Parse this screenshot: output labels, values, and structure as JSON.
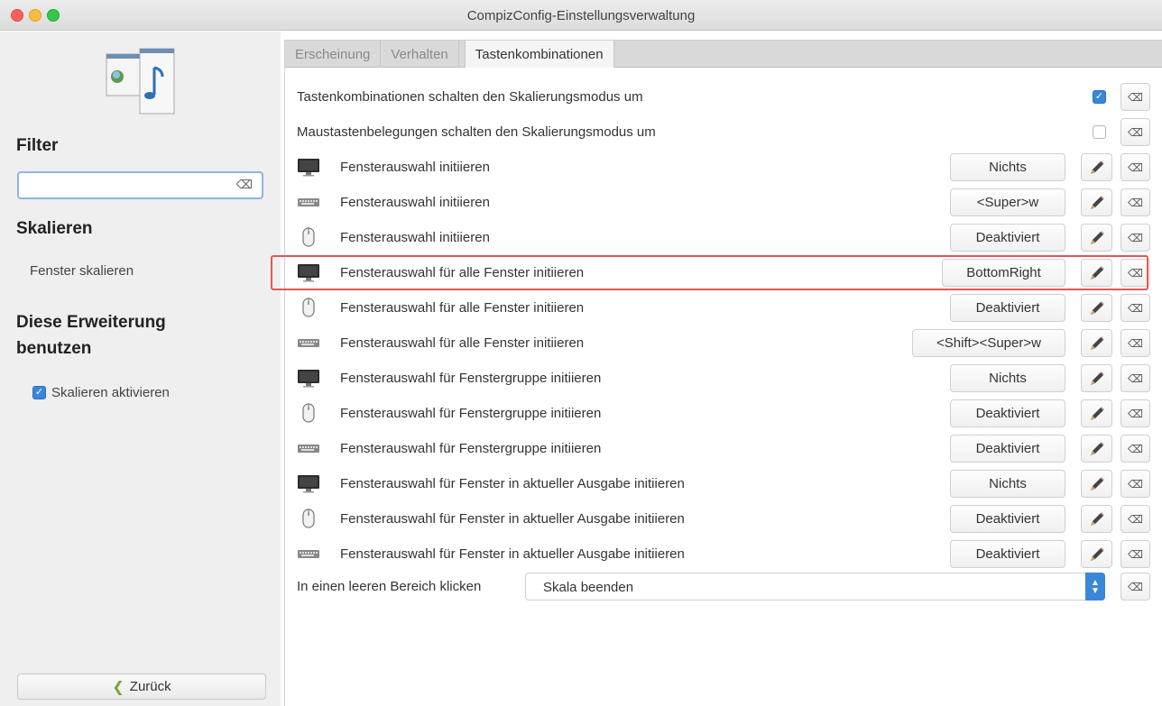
{
  "window": {
    "title": "CompizConfig-Einstellungsverwaltung"
  },
  "sidebar": {
    "filter_heading": "Filter",
    "filter_placeholder": "",
    "plugin_heading": "Skalieren",
    "plugin_item": "Fenster skalieren",
    "use_heading_line1": "Diese Erweiterung",
    "use_heading_line2": "benutzen",
    "enable_label": "Skalieren aktivieren",
    "enable_checked": true,
    "back_label": "Zurück"
  },
  "tabs": [
    {
      "label": "Erscheinung",
      "active": false
    },
    {
      "label": "Verhalten",
      "active": false
    },
    {
      "label": "Tastenkombinationen",
      "active": true
    }
  ],
  "toggles": [
    {
      "label": "Tastenkombinationen schalten den Skalierungsmodus um",
      "checked": true
    },
    {
      "label": "Maustastenbelegungen schalten den Skalierungsmodus um",
      "checked": false
    }
  ],
  "bindings": [
    {
      "icon": "monitor-icon",
      "label": "Fensterauswahl initiieren",
      "value": "Nichts"
    },
    {
      "icon": "keyboard-icon",
      "label": "Fensterauswahl initiieren",
      "value": "<Super>w"
    },
    {
      "icon": "mouse-icon",
      "label": "Fensterauswahl initiieren",
      "value": "Deaktiviert"
    },
    {
      "icon": "monitor-icon",
      "label": "Fensterauswahl für alle Fenster initiieren",
      "value": "BottomRight"
    },
    {
      "icon": "mouse-icon",
      "label": "Fensterauswahl für alle Fenster initiieren",
      "value": "Deaktiviert"
    },
    {
      "icon": "keyboard-icon",
      "label": "Fensterauswahl für alle Fenster initiieren",
      "value": "<Shift><Super>w"
    },
    {
      "icon": "monitor-icon",
      "label": "Fensterauswahl für Fenstergruppe initiieren",
      "value": "Nichts"
    },
    {
      "icon": "mouse-icon",
      "label": "Fensterauswahl für Fenstergruppe initiieren",
      "value": "Deaktiviert"
    },
    {
      "icon": "keyboard-icon",
      "label": "Fensterauswahl für Fenstergruppe initiieren",
      "value": "Deaktiviert"
    },
    {
      "icon": "monitor-icon",
      "label": "Fensterauswahl für Fenster in aktueller Ausgabe initiieren",
      "value": "Nichts"
    },
    {
      "icon": "mouse-icon",
      "label": "Fensterauswahl für Fenster in aktueller Ausgabe initiieren",
      "value": "Deaktiviert"
    },
    {
      "icon": "keyboard-icon",
      "label": "Fensterauswahl für Fenster in aktueller Ausgabe initiieren",
      "value": "Deaktiviert"
    }
  ],
  "empty_click": {
    "label": "In einen leeren Bereich klicken",
    "value": "Skala beenden"
  },
  "colors": {
    "accent": "#3a86d8",
    "highlight": "#e35656"
  }
}
